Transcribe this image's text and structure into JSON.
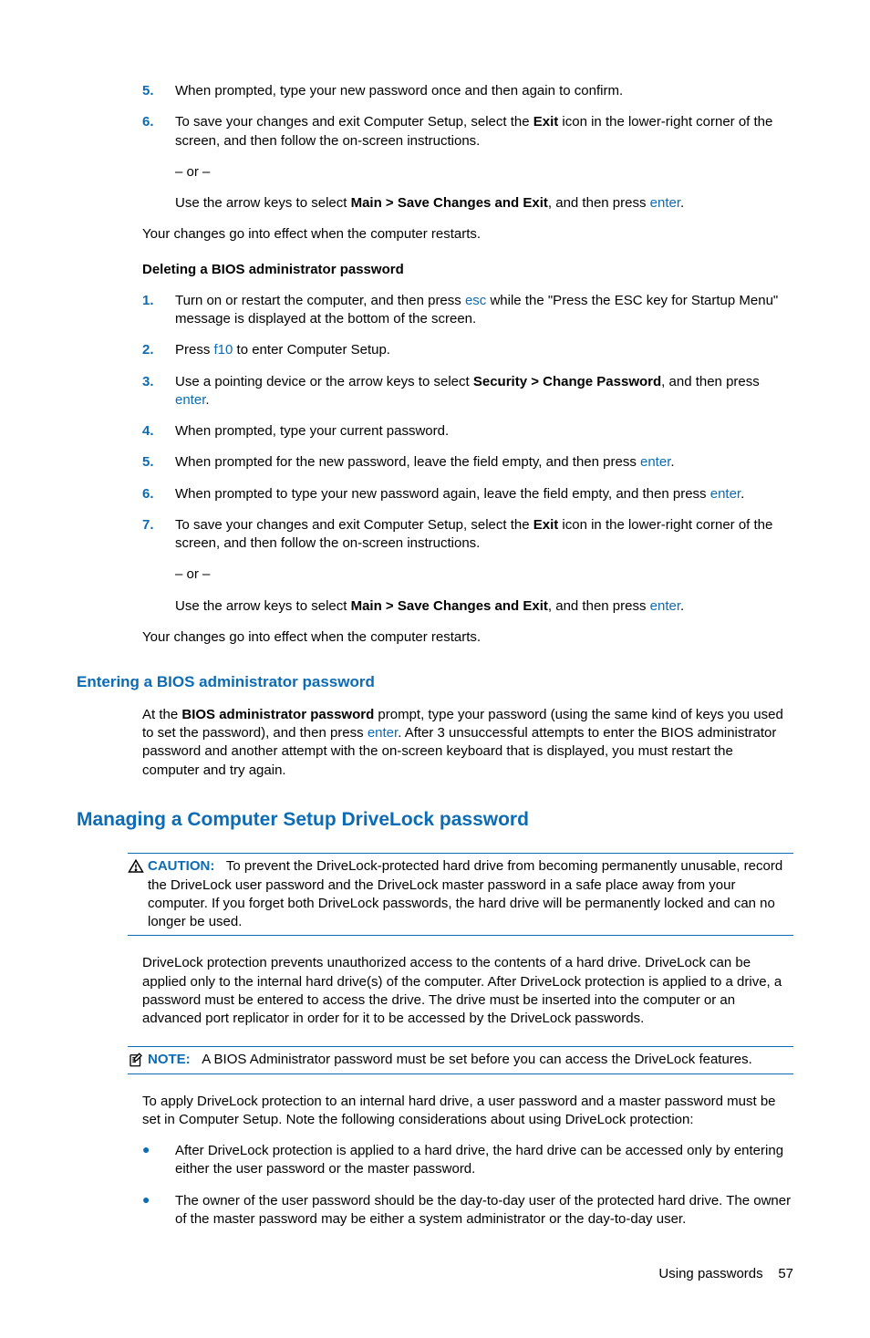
{
  "topList": {
    "item5": "When prompted, type your new password once and then again to confirm.",
    "item6a_before": "To save your changes and exit Computer Setup, select the ",
    "item6a_bold": "Exit",
    "item6a_after": " icon in the lower-right corner of the screen, and then follow the on-screen instructions.",
    "or": "– or –",
    "item6b_before": "Use the arrow keys to select ",
    "item6b_bold": "Main > Save Changes and Exit",
    "item6b_after1": ", and then press ",
    "item6b_key": "enter",
    "item6b_after2": "."
  },
  "restartNote1": "Your changes go into effect when the computer restarts.",
  "deleteHeading": "Deleting a BIOS administrator password",
  "delList": {
    "n1": "1.",
    "i1a": "Turn on or restart the computer, and then press ",
    "i1key": "esc",
    "i1b": " while the \"Press the ESC key for Startup Menu\" message is displayed at the bottom of the screen.",
    "n2": "2.",
    "i2a": "Press ",
    "i2key": "f10",
    "i2b": " to enter Computer Setup.",
    "n3": "3.",
    "i3a": "Use a pointing device or the arrow keys to select ",
    "i3bold": "Security > Change Password",
    "i3b": ", and then press ",
    "i3key": "enter",
    "i3c": ".",
    "n4": "4.",
    "i4": "When prompted, type your current password.",
    "n5": "5.",
    "i5a": "When prompted for the new password, leave the field empty, and then press ",
    "i5key": "enter",
    "i5b": ".",
    "n6": "6.",
    "i6a": "When prompted to type your new password again, leave the field empty, and then press ",
    "i6key": "enter",
    "i6b": ".",
    "n7": "7.",
    "i7a_before": "To save your changes and exit Computer Setup, select the ",
    "i7a_bold": "Exit",
    "i7a_after": " icon in the lower-right corner of the screen, and then follow the on-screen instructions.",
    "i7or": "– or –",
    "i7b_before": "Use the arrow keys to select ",
    "i7b_bold": "Main > Save Changes and Exit",
    "i7b_after1": ", and then press ",
    "i7b_key": "enter",
    "i7b_after2": "."
  },
  "restartNote2": "Your changes go into effect when the computer restarts.",
  "enteringHeading": "Entering a BIOS administrator password",
  "entering": {
    "a": "At the ",
    "bold": "BIOS administrator password",
    "b": " prompt, type your password (using the same kind of keys you used to set the password), and then press ",
    "key": "enter",
    "c": ". After 3 unsuccessful attempts to enter the BIOS administrator password and another attempt with the on-screen keyboard that is displayed, you must restart the computer and try again."
  },
  "managingHeading": "Managing a Computer Setup DriveLock password",
  "caution": {
    "label": "CAUTION:",
    "text": "To prevent the DriveLock-protected hard drive from becoming permanently unusable, record the DriveLock user password and the DriveLock master password in a safe place away from your computer. If you forget both DriveLock passwords, the hard drive will be permanently locked and can no longer be used."
  },
  "drivelockPara": "DriveLock protection prevents unauthorized access to the contents of a hard drive. DriveLock can be applied only to the internal hard drive(s) of the computer. After DriveLock protection is applied to a drive, a password must be entered to access the drive. The drive must be inserted into the computer or an advanced port replicator in order for it to be accessed by the DriveLock passwords.",
  "note": {
    "label": "NOTE:",
    "text": "A BIOS Administrator password must be set before you can access the DriveLock features."
  },
  "applyPara": "To apply DriveLock protection to an internal hard drive, a user password and a master password must be set in Computer Setup. Note the following considerations about using DriveLock protection:",
  "bullets": {
    "b1": "After DriveLock protection is applied to a hard drive, the hard drive can be accessed only by entering either the user password or the master password.",
    "b2": "The owner of the user password should be the day-to-day user of the protected hard drive. The owner of the master password may be either a system administrator or the day-to-day user."
  },
  "footer": {
    "label": "Using passwords",
    "page": "57"
  },
  "nums": {
    "n5": "5.",
    "n6": "6."
  }
}
